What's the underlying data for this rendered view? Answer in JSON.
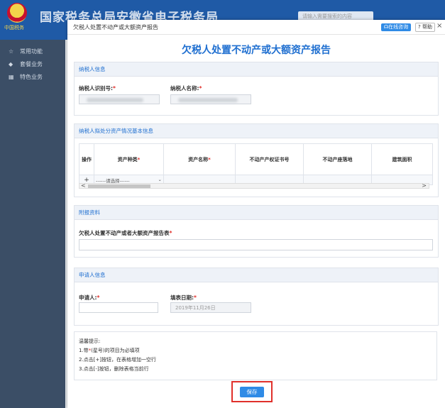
{
  "site": {
    "title": "国家税务总局安徽省电子税务局",
    "emblem_caption": "中国税务",
    "search_placeholder": "请输入需要搜索的内容"
  },
  "sidebar": {
    "items": [
      {
        "icon": "star-icon",
        "label": "常用功能"
      },
      {
        "icon": "layers-icon",
        "label": "套餐业务"
      },
      {
        "icon": "grid-icon",
        "label": "特色业务"
      }
    ]
  },
  "dialog": {
    "window_title": "欠税人处置不动产或大额资产报告",
    "online_btn": "在线咨询",
    "help_btn": "帮助",
    "close": "×",
    "heading": "欠税人处置不动产或大额资产报告"
  },
  "taxpayer": {
    "section_title": "纳税人信息",
    "id_label": "纳税人识别号:",
    "name_label": "纳税人名称:"
  },
  "assets": {
    "section_title": "纳税人拟处分资产情况基本信息",
    "columns": [
      "操作",
      "资产种类",
      "资产名称",
      "不动产产权证书号",
      "不动产座落地",
      "建筑面积"
    ],
    "required_cols": [
      false,
      true,
      true,
      false,
      false,
      false
    ],
    "row": {
      "op": "+",
      "select_value": "------请选择------"
    },
    "scroll_left": "<",
    "scroll_right": ">"
  },
  "attach": {
    "section_title": "附报资料",
    "field_label": "欠税人处置不动产或者大额资产报告表"
  },
  "applicant": {
    "section_title": "申请人信息",
    "applicant_label": "申请人:",
    "date_label": "填表日期:",
    "date_value": "2019年11月26日"
  },
  "tips": {
    "title": "温馨提示:",
    "line1_prefix": "1.带",
    "line1_star": "*",
    "line1_suffix": "(星号)的项目为必填项",
    "line2": "2.点击[+]按钮，在表格增加一空行",
    "line3": "3.点击[-]按钮，删除表格当前行"
  },
  "save_button": "保存",
  "required_mark": "*",
  "colors": {
    "accent": "#1f6fd0",
    "required": "#e0302b",
    "highlight": "#e0302b",
    "button": "#2f8be6"
  }
}
